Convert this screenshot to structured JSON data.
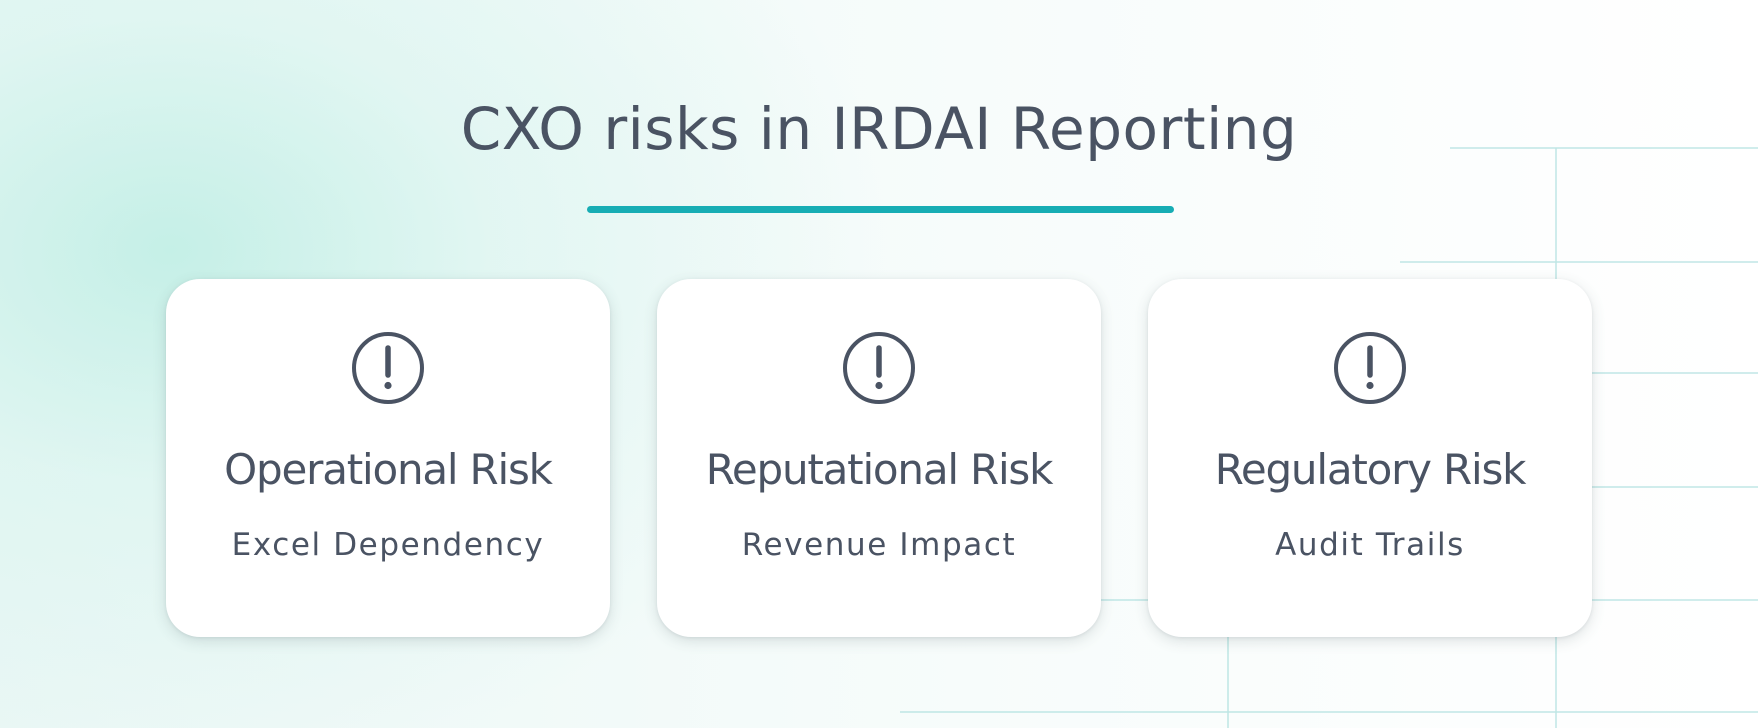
{
  "header": {
    "title": "CXO risks in IRDAI Reporting"
  },
  "colors": {
    "accent": "#17adb4",
    "text": "#4a5363",
    "card_background": "#ffffff"
  },
  "cards": [
    {
      "icon": "exclamation-circle-icon",
      "title": "Operational Risk",
      "subtitle": "Excel Dependency"
    },
    {
      "icon": "exclamation-circle-icon",
      "title": "Reputational Risk",
      "subtitle": "Revenue Impact"
    },
    {
      "icon": "exclamation-circle-icon",
      "title": "Regulatory Risk",
      "subtitle": "Audit Trails"
    }
  ]
}
